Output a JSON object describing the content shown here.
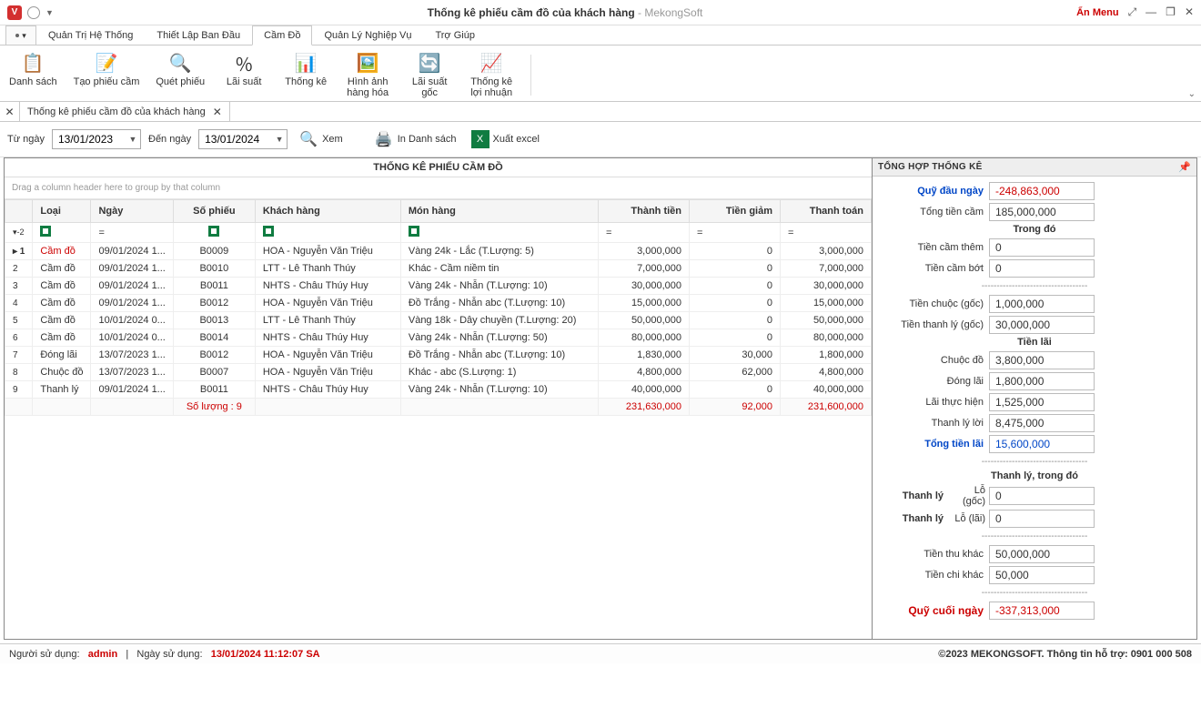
{
  "titlebar": {
    "title_strong": "Thống kê phiếu cầm đồ của khách hàng",
    "title_light": " - MekongSoft",
    "hide_menu": "Ẩn Menu"
  },
  "menu_tabs": [
    "Quản Trị Hệ Thống",
    "Thiết Lập Ban Đầu",
    "Cầm Đồ",
    "Quản Lý Nghiệp Vụ",
    "Trợ Giúp"
  ],
  "menu_active_index": 2,
  "ribbon": [
    {
      "icon": "📋",
      "label": "Danh sách"
    },
    {
      "icon": "📝",
      "label": "Tạo phiếu cầm"
    },
    {
      "icon": "🔍",
      "label": "Quét phiếu"
    },
    {
      "icon": "％",
      "label": "Lãi suất"
    },
    {
      "icon": "📊",
      "label": "Thống kê"
    },
    {
      "icon": "🖼️",
      "label": "Hình ảnh\nhàng hóa"
    },
    {
      "icon": "🔄",
      "label": "Lãi suất\ngốc"
    },
    {
      "icon": "📈",
      "label": "Thống kê\nlợi nhuận"
    }
  ],
  "doc_tab_title": "Thống kê phiếu cầm đồ của khách hàng",
  "filters": {
    "from_label": "Từ ngày",
    "from_value": "13/01/2023",
    "to_label": "Đến ngày",
    "to_value": "13/01/2024",
    "view_btn": "Xem",
    "print_btn": "In Danh sách",
    "excel_btn": "Xuất excel"
  },
  "grid": {
    "title": "THỐNG KÊ PHIẾU CẦM ĐỒ",
    "group_hint": "Drag a column header here to group by that column",
    "columns": [
      "Loại",
      "Ngày",
      "Số phiếu",
      "Khách hàng",
      "Món hàng",
      "Thành tiền",
      "Tiền giảm",
      "Thanh toán"
    ],
    "filter_marker": "▾-2",
    "rows": [
      {
        "idx": "1",
        "loai": "Cầm đồ",
        "ngay": "09/01/2024 1...",
        "sophieu": "B0009",
        "kh": "HOA - Nguyễn Văn Triệu",
        "mon": "Vàng 24k - Lắc (T.Lượng: 5)",
        "tt": "3,000,000",
        "giam": "0",
        "thanh": "3,000,000",
        "sel": true
      },
      {
        "idx": "2",
        "loai": "Cầm đồ",
        "ngay": "09/01/2024 1...",
        "sophieu": "B0010",
        "kh": "LTT - Lê Thanh Thúy",
        "mon": "Khác - Cầm niềm tin",
        "tt": "7,000,000",
        "giam": "0",
        "thanh": "7,000,000"
      },
      {
        "idx": "3",
        "loai": "Cầm đồ",
        "ngay": "09/01/2024 1...",
        "sophieu": "B0011",
        "kh": "NHTS - Châu Thúy Huy",
        "mon": "Vàng 24k - Nhẫn (T.Lượng: 10)",
        "tt": "30,000,000",
        "giam": "0",
        "thanh": "30,000,000"
      },
      {
        "idx": "4",
        "loai": "Cầm đồ",
        "ngay": "09/01/2024 1...",
        "sophieu": "B0012",
        "kh": "HOA - Nguyễn Văn Triệu",
        "mon": "Đồ Trắng - Nhẫn abc (T.Lượng: 10)",
        "tt": "15,000,000",
        "giam": "0",
        "thanh": "15,000,000"
      },
      {
        "idx": "5",
        "loai": "Cầm đồ",
        "ngay": "10/01/2024 0...",
        "sophieu": "B0013",
        "kh": "LTT - Lê Thanh Thúy",
        "mon": "Vàng 18k - Dây chuyền (T.Lượng: 20)",
        "tt": "50,000,000",
        "giam": "0",
        "thanh": "50,000,000"
      },
      {
        "idx": "6",
        "loai": "Cầm đồ",
        "ngay": "10/01/2024 0...",
        "sophieu": "B0014",
        "kh": "NHTS - Châu Thúy Huy",
        "mon": "Vàng 24k - Nhẫn (T.Lượng: 50)",
        "tt": "80,000,000",
        "giam": "0",
        "thanh": "80,000,000"
      },
      {
        "idx": "7",
        "loai": "Đóng lãi",
        "ngay": "13/07/2023 1...",
        "sophieu": "B0012",
        "kh": "HOA - Nguyễn Văn Triệu",
        "mon": "Đồ Trắng - Nhẫn abc (T.Lượng: 10)",
        "tt": "1,830,000",
        "giam": "30,000",
        "thanh": "1,800,000"
      },
      {
        "idx": "8",
        "loai": "Chuộc đồ",
        "ngay": "13/07/2023 1...",
        "sophieu": "B0007",
        "kh": "HOA - Nguyễn Văn Triệu",
        "mon": "Khác - abc (S.Lượng: 1)",
        "tt": "4,800,000",
        "giam": "62,000",
        "thanh": "4,800,000"
      },
      {
        "idx": "9",
        "loai": "Thanh lý",
        "ngay": "09/01/2024 1...",
        "sophieu": "B0011",
        "kh": "NHTS - Châu Thúy Huy",
        "mon": "Vàng 24k - Nhẫn (T.Lượng: 10)",
        "tt": "40,000,000",
        "giam": "0",
        "thanh": "40,000,000"
      }
    ],
    "totals": {
      "count": "Số lượng : 9",
      "tt": "231,630,000",
      "giam": "92,000",
      "thanh": "231,600,000"
    }
  },
  "summary": {
    "title": "TỔNG HỢP THỐNG KÊ",
    "quy_dau_label": "Quỹ đầu ngày",
    "quy_dau": "-248,863,000",
    "tong_cam_label": "Tổng tiền cầm",
    "tong_cam": "185,000,000",
    "trong_do": "Trong đó",
    "cam_them_label": "Tiền cầm thêm",
    "cam_them": "0",
    "cam_bot_label": "Tiền cầm bớt",
    "cam_bot": "0",
    "chuoc_goc_label": "Tiền chuộc (gốc)",
    "chuoc_goc": "1,000,000",
    "thanhly_goc_label": "Tiền thanh lý (gốc)",
    "thanhly_goc": "30,000,000",
    "tien_lai_head": "Tiền lãi",
    "chuoc_do_label": "Chuộc đồ",
    "chuoc_do": "3,800,000",
    "dong_lai_label": "Đóng lãi",
    "dong_lai": "1,800,000",
    "lai_thuc_label": "Lãi thực hiện",
    "lai_thuc": "1,525,000",
    "thanhly_loi_label": "Thanh lý lời",
    "thanhly_loi": "8,475,000",
    "tong_lai_label": "Tổng tiền lãi",
    "tong_lai": "15,600,000",
    "tl_trongdo": "Thanh lý,  trong đó",
    "tl_label": "Thanh lý",
    "lo_goc_label": "Lỗ (gốc)",
    "lo_goc": "0",
    "lo_lai_label": "Lỗ (lãi)",
    "lo_lai": "0",
    "thu_khac_label": "Tiền thu khác",
    "thu_khac": "50,000,000",
    "chi_khac_label": "Tiền chi khác",
    "chi_khac": "50,000",
    "quy_cuoi_label": "Quỹ cuối ngày",
    "quy_cuoi": "-337,313,000"
  },
  "statusbar": {
    "user_label": "Người sử dụng:",
    "user": "admin",
    "date_label": "Ngày sử dụng:",
    "date": "13/01/2024 11:12:07 SA",
    "copyright": "©2023 MEKONGSOFT. Thông tin hỗ trợ: 0901 000 508"
  }
}
